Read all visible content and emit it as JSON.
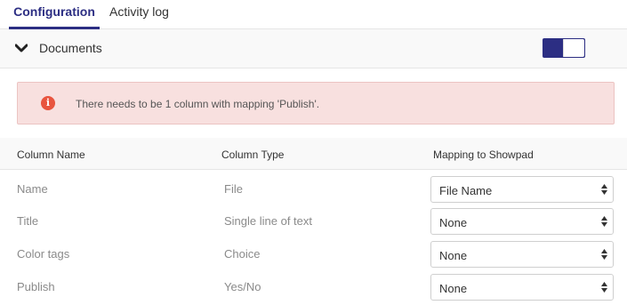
{
  "tabs": [
    {
      "label": "Configuration",
      "active": true
    },
    {
      "label": "Activity log",
      "active": false
    }
  ],
  "section": {
    "title": "Documents",
    "toggle_on": true,
    "toggle_color": "#2c2e83"
  },
  "alert": {
    "icon": "info-icon",
    "icon_glyph": "i",
    "message": "There needs to be 1 column with mapping 'Publish'."
  },
  "table": {
    "headers": [
      "Column Name",
      "Column Type",
      "Mapping to Showpad"
    ],
    "rows": [
      {
        "name": "Name",
        "type": "File",
        "mapping": "File Name"
      },
      {
        "name": "Title",
        "type": "Single line of text",
        "mapping": "None"
      },
      {
        "name": "Color tags",
        "type": "Choice",
        "mapping": "None"
      },
      {
        "name": "Publish",
        "type": "Yes/No",
        "mapping": "None"
      }
    ]
  }
}
